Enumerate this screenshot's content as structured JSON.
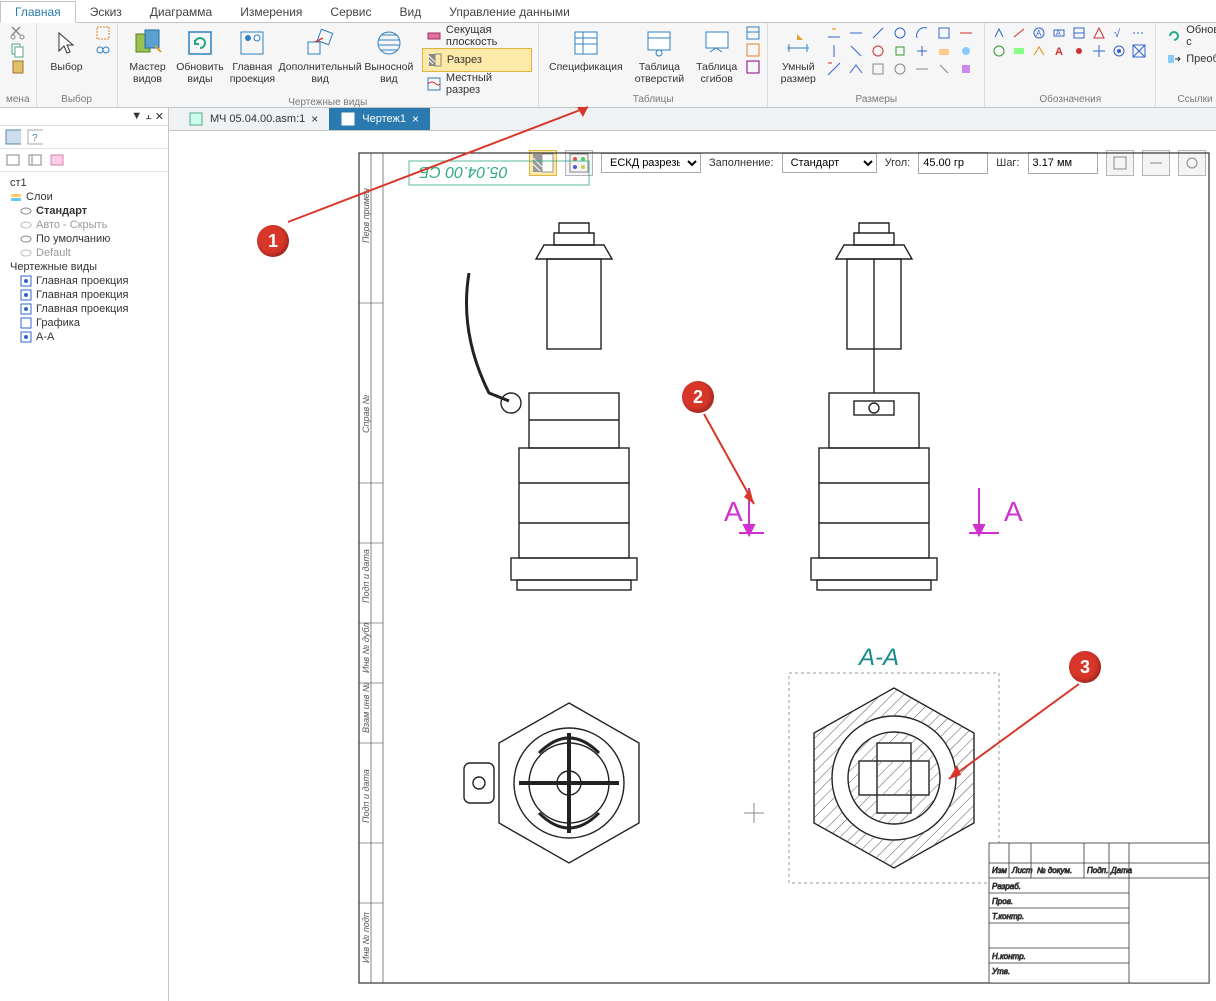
{
  "ribbonTabs": [
    "Главная",
    "Эскиз",
    "Диаграмма",
    "Измерения",
    "Сервис",
    "Вид",
    "Управление данными"
  ],
  "activeRibbonTab": 0,
  "groups": {
    "mena": {
      "label": "мена"
    },
    "selection": {
      "label": "Выбор",
      "select": "Выбор"
    },
    "views": {
      "label": "Чертежные виды",
      "master": "Мастер\nвидов",
      "update": "Обновить\nвиды",
      "main_proj": "Главная\nпроекция",
      "aux": "Дополнительный\nвид",
      "detail": "Выносной\nвид",
      "cutting_plane": "Секущая плоскость",
      "section": "Разрез",
      "local_section": "Местный разрез"
    },
    "tables": {
      "label": "Таблицы",
      "spec": "Спецификация",
      "holes": "Таблица\nотверстий",
      "bends": "Таблица\nсгибов"
    },
    "dims": {
      "label": "Размеры",
      "smart": "Умный\nразмер"
    },
    "annot": {
      "label": "Обозначения"
    },
    "links": {
      "label": "Ссылки атр",
      "update": "Обновить с",
      "convert": "Преобразо"
    }
  },
  "docTabs": [
    {
      "label": "МЧ 05.04.00.asm:1",
      "active": false
    },
    {
      "label": "Чертеж1",
      "active": true
    }
  ],
  "leftHeader": {
    "pin": "⊼",
    "dropdown": "▾",
    "close": "✕"
  },
  "tree": {
    "root": "ст1",
    "layers_label": "Слои",
    "layers": [
      "Стандарт",
      "Авто - Скрыть",
      "По умолчанию",
      "Default"
    ],
    "views_label": "Чертежные виды",
    "views": [
      "Главная проекция",
      "Главная проекция",
      "Главная проекция",
      "Графика",
      "A-A"
    ]
  },
  "contextBar": {
    "dropdown": "ЕСКД разрезы",
    "fill_label": "Заполнение:",
    "fill_value": "Стандарт",
    "angle_label": "Угол:",
    "angle_value": "45.00 гр",
    "step_label": "Шаг:",
    "step_value": "3.17 мм"
  },
  "drawing": {
    "section_mark_letter": "А",
    "section_title": "А-А",
    "stamp_text": "05.04.00 СБ",
    "titleblock": {
      "row1": [
        "Изм",
        "Лист",
        "№ докум.",
        "Подп.",
        "Дата"
      ],
      "row_roles": [
        "Разраб.",
        "Пров.",
        "Т.контр.",
        "Н.контр.",
        "Утв."
      ]
    },
    "side_labels": [
      "Перв примен",
      "Справ №",
      "Подп и дата",
      "Инв № дубл",
      "Взам инв №",
      "Подп и дата",
      "Инв № подп"
    ]
  },
  "callouts": {
    "c1": "1",
    "c2": "2",
    "c3": "3"
  }
}
